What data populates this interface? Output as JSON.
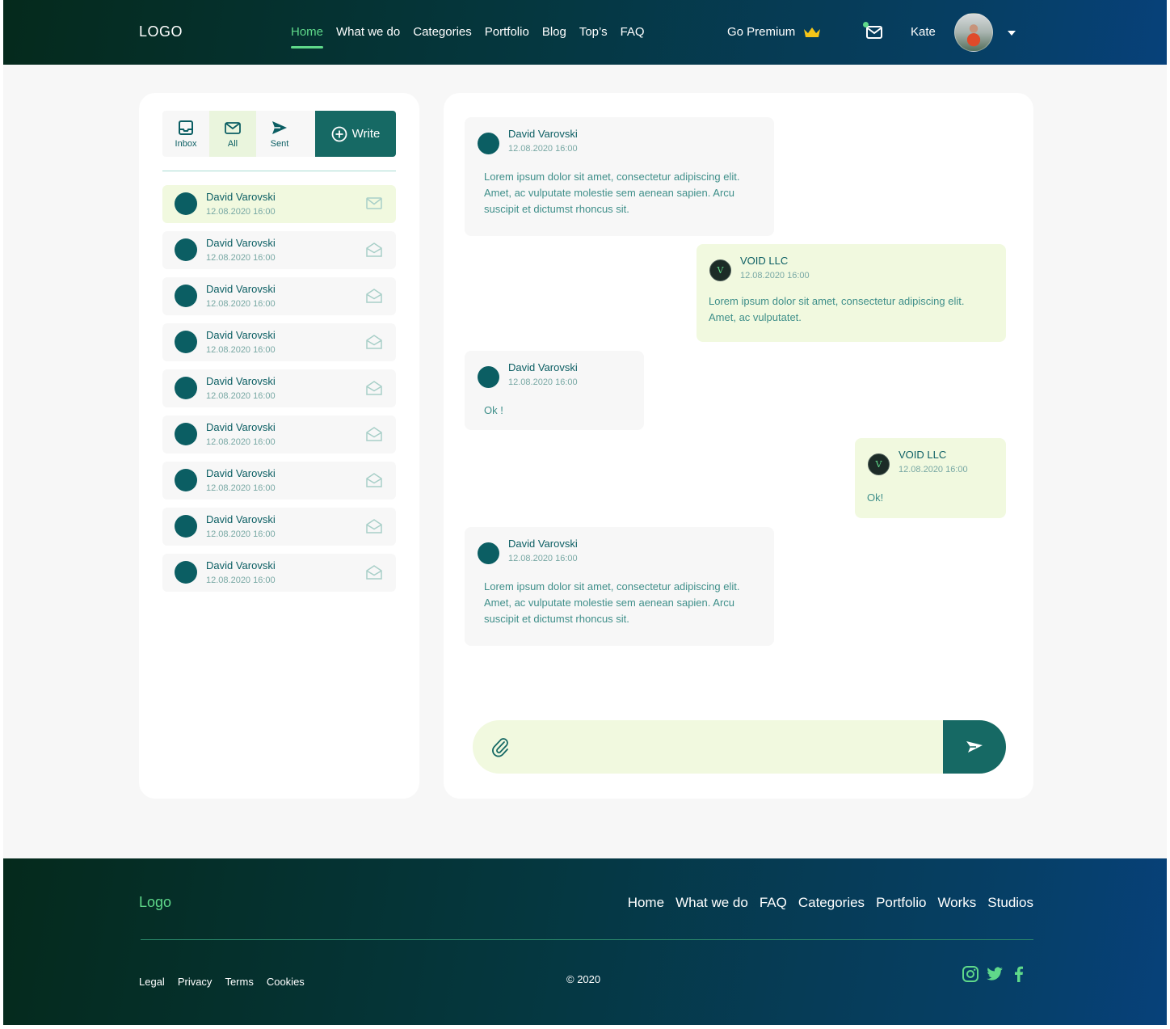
{
  "header": {
    "logo": "LOGO",
    "nav": [
      "Home",
      "What we do",
      "Categories",
      "Portfolio",
      "Blog",
      "Top’s",
      "FAQ"
    ],
    "active_nav": "Home",
    "premium_label": "Go Premium",
    "user_name": "Kate"
  },
  "sidebar": {
    "tabs": [
      {
        "label": "Inbox",
        "icon": "inbox-icon"
      },
      {
        "label": "All",
        "icon": "mail-icon"
      },
      {
        "label": "Sent",
        "icon": "send-icon"
      }
    ],
    "active_tab": "All",
    "write_label": "Write",
    "threads": [
      {
        "name": "David Varovski",
        "date": "12.08.2020  16:00",
        "read": false
      },
      {
        "name": "David Varovski",
        "date": "12.08.2020  16:00",
        "read": true
      },
      {
        "name": "David Varovski",
        "date": "12.08.2020  16:00",
        "read": true
      },
      {
        "name": "David Varovski",
        "date": "12.08.2020  16:00",
        "read": true
      },
      {
        "name": "David Varovski",
        "date": "12.08.2020  16:00",
        "read": true
      },
      {
        "name": "David Varovski",
        "date": "12.08.2020  16:00",
        "read": true
      },
      {
        "name": "David Varovski",
        "date": "12.08.2020  16:00",
        "read": true
      },
      {
        "name": "David Varovski",
        "date": "12.08.2020  16:00",
        "read": true
      },
      {
        "name": "David Varovski",
        "date": "12.08.2020  16:00",
        "read": true
      }
    ]
  },
  "chat": {
    "messages": [
      {
        "from": "David Varovski",
        "date": "12.08.2020  16:00",
        "text": "Lorem ipsum dolor sit amet, consectetur adipiscing elit. Amet, ac vulputate molestie sem aenean sapien. Arcu suscipit et dictumst rhoncus sit.",
        "direction": "in"
      },
      {
        "from": "VOID LLC",
        "date": "12.08.2020  16:00",
        "text": "Lorem ipsum dolor sit amet, consectetur adipiscing elit. Amet, ac vulputatet.",
        "direction": "out"
      },
      {
        "from": "David Varovski",
        "date": "12.08.2020  16:00",
        "text": "Ok !",
        "direction": "in"
      },
      {
        "from": "VOID LLC",
        "date": "12.08.2020  16:00",
        "text": "Ok!",
        "direction": "out"
      },
      {
        "from": "David Varovski",
        "date": "12.08.2020  16:00",
        "text": "Lorem ipsum dolor sit amet, consectetur adipiscing elit. Amet, ac vulputate molestie sem aenean sapien. Arcu suscipit et dictumst rhoncus sit.",
        "direction": "in"
      }
    ],
    "composer_value": "",
    "void_avatar_letter": "V"
  },
  "footer": {
    "logo": "Logo",
    "nav": [
      "Home",
      "What we do",
      "FAQ",
      "Categories",
      "Portfolio",
      "Works",
      "Studios"
    ],
    "legal": [
      "Legal",
      "Privacy",
      "Terms",
      "Cookies"
    ],
    "copyright": "© 2020",
    "social": [
      "instagram-icon",
      "twitter-icon",
      "facebook-icon"
    ]
  },
  "colors": {
    "brand_teal": "#166964",
    "accent_green": "#5fd98a",
    "light_green": "#f1f9df",
    "crown": "#f5c518"
  }
}
